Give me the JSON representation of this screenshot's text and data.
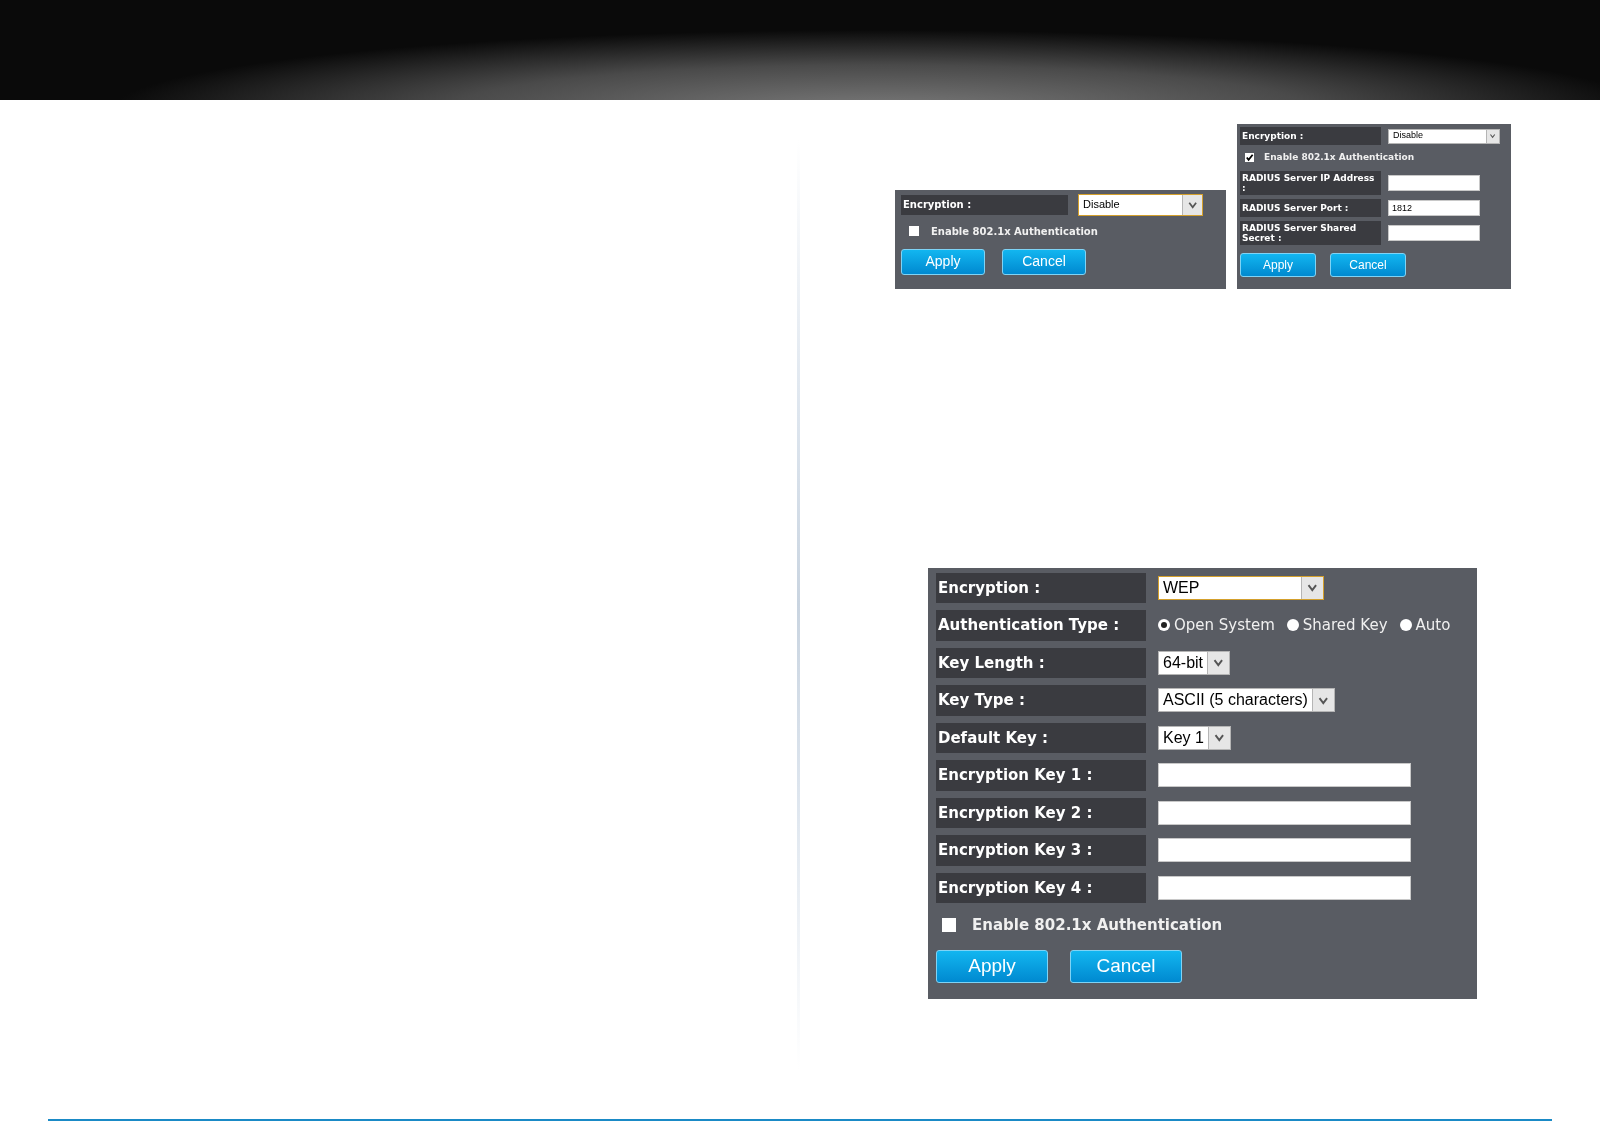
{
  "panels": [
    {
      "rows": [
        {
          "kind": "dropdown",
          "label": "Encryption :",
          "value": "Disable",
          "focused": true
        },
        {
          "kind": "checkbox",
          "label": "Enable 802.1x Authentication",
          "checked": false
        }
      ],
      "buttons": [
        "Apply",
        "Cancel"
      ]
    },
    {
      "rows": [
        {
          "kind": "dropdown",
          "label": "Encryption :",
          "value": "Disable",
          "focused": false
        },
        {
          "kind": "checkbox",
          "label": "Enable 802.1x Authentication",
          "checked": true
        },
        {
          "kind": "text",
          "label": "RADIUS Server IP Address :"
        },
        {
          "kind": "text",
          "label": "RADIUS Server Port :",
          "value": "1812"
        },
        {
          "kind": "text",
          "label": "RADIUS Server Shared Secret :"
        }
      ],
      "buttons": [
        "Apply",
        "Cancel"
      ]
    },
    {
      "rows": [
        {
          "kind": "dropdown",
          "label": "Encryption :",
          "value": "WEP",
          "focused": true
        },
        {
          "kind": "radio",
          "label": "Authentication Type :",
          "options": [
            {
              "label": "Open System",
              "selected": true
            },
            {
              "label": "Shared Key",
              "selected": false
            },
            {
              "label": "Auto",
              "selected": false
            }
          ]
        },
        {
          "kind": "select",
          "label": "Key Length :",
          "value": "64-bit"
        },
        {
          "kind": "select",
          "label": "Key Type :",
          "value": "ASCII (5 characters)"
        },
        {
          "kind": "select",
          "label": "Default Key :",
          "value": "Key 1"
        },
        {
          "kind": "text",
          "label": "Encryption Key 1 :"
        },
        {
          "kind": "text",
          "label": "Encryption Key 2 :"
        },
        {
          "kind": "text",
          "label": "Encryption Key 3 :"
        },
        {
          "kind": "text",
          "label": "Encryption Key 4 :"
        },
        {
          "kind": "checkbox",
          "label": "Enable 802.1x Authentication",
          "checked": false
        }
      ],
      "buttons": [
        "Apply",
        "Cancel"
      ]
    }
  ]
}
